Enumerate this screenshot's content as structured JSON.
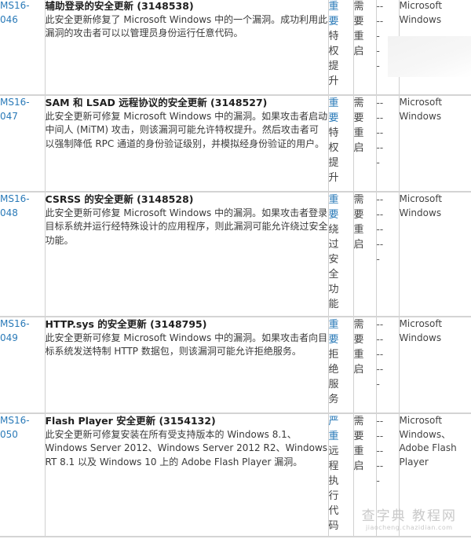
{
  "bulletins": [
    {
      "id_line1": "MS16-",
      "id_line2": "046",
      "title": "辅助登录的安全更新 (3148538)",
      "description": "此安全更新修复了 Microsoft Windows 中的一个漏洞。成功利用此漏洞的攻击者可以以管理员身份运行任意代码。",
      "severity_level": [
        "重",
        "要"
      ],
      "impact": [
        "特",
        "权",
        "提",
        "升"
      ],
      "restart": [
        "需",
        "要",
        "重",
        "启"
      ],
      "known_issues": [
        "--",
        "--",
        "-",
        "-",
        "-"
      ],
      "software": "Microsoft Windows"
    },
    {
      "id_line1": "MS16-",
      "id_line2": "047",
      "title": "SAM 和 LSAD 远程协议的安全更新 (3148527)",
      "description": "此安全更新可修复 Microsoft Windows 中的漏洞。如果攻击者启动中间人 (MiTM) 攻击，则该漏洞可能允许特权提升。然后攻击者可以强制降低 RPC 通道的身份验证级别，并模拟经身份验证的用户。",
      "severity_level": [
        "重",
        "要"
      ],
      "impact": [
        "特",
        "权",
        "提",
        "升"
      ],
      "restart": [
        "需",
        "要",
        "重",
        "启"
      ],
      "known_issues": [
        "--",
        "--",
        "--",
        "--",
        "-"
      ],
      "software": "Microsoft Windows"
    },
    {
      "id_line1": "MS16-",
      "id_line2": "048",
      "title": "CSRSS 的安全更新 (3148528)",
      "description": "此安全更新可修复 Microsoft Windows 中的漏洞。如果攻击者登录目标系统并运行经特殊设计的应用程序，则此漏洞可能允许绕过安全功能。",
      "severity_level": [
        "重",
        "要"
      ],
      "impact": [
        "绕",
        "过",
        "安",
        "全",
        "功",
        "能"
      ],
      "restart": [
        "需",
        "要",
        "重",
        "启"
      ],
      "known_issues": [
        "--",
        "--",
        "--",
        "--",
        "-"
      ],
      "software": "Microsoft Windows"
    },
    {
      "id_line1": "MS16-",
      "id_line2": "049",
      "title": "HTTP.sys 的安全更新 (3148795)",
      "description": "此安全更新可修复 Microsoft Windows 中的漏洞。如果攻击者向目标系统发送特制 HTTP 数据包，则该漏洞可能允许拒绝服务。",
      "severity_level": [
        "重",
        "要"
      ],
      "impact": [
        "拒",
        "绝",
        "服",
        "务"
      ],
      "restart": [
        "需",
        "要",
        "重",
        "启"
      ],
      "known_issues": [
        "--",
        "--",
        "--",
        "--",
        "-"
      ],
      "software": "Microsoft Windows"
    },
    {
      "id_line1": "MS16-",
      "id_line2": "050",
      "title": "Flash Player 安全更新 (3154132)",
      "description": "此安全更新可修复安装在所有受支持版本的 Windows 8.1、Windows Server 2012、Windows Server 2012 R2、Windows RT 8.1 以及 Windows 10 上的 Adobe Flash Player 漏洞。",
      "severity_level": [
        "严",
        "重"
      ],
      "impact": [
        "远",
        "程",
        "执",
        "行",
        "代",
        "码"
      ],
      "restart": [
        "需",
        "要",
        "重",
        "启"
      ],
      "known_issues": [
        "--",
        "--",
        "--",
        "--",
        "-"
      ],
      "software": "Microsoft Windows、Adobe Flash Player"
    }
  ],
  "watermark": {
    "main": "查字典 教程网",
    "sub": "jiaocheng.chazidian.com"
  },
  "colors": {
    "link_blue": "#2a7ab8",
    "border": "#d0d0d0"
  }
}
